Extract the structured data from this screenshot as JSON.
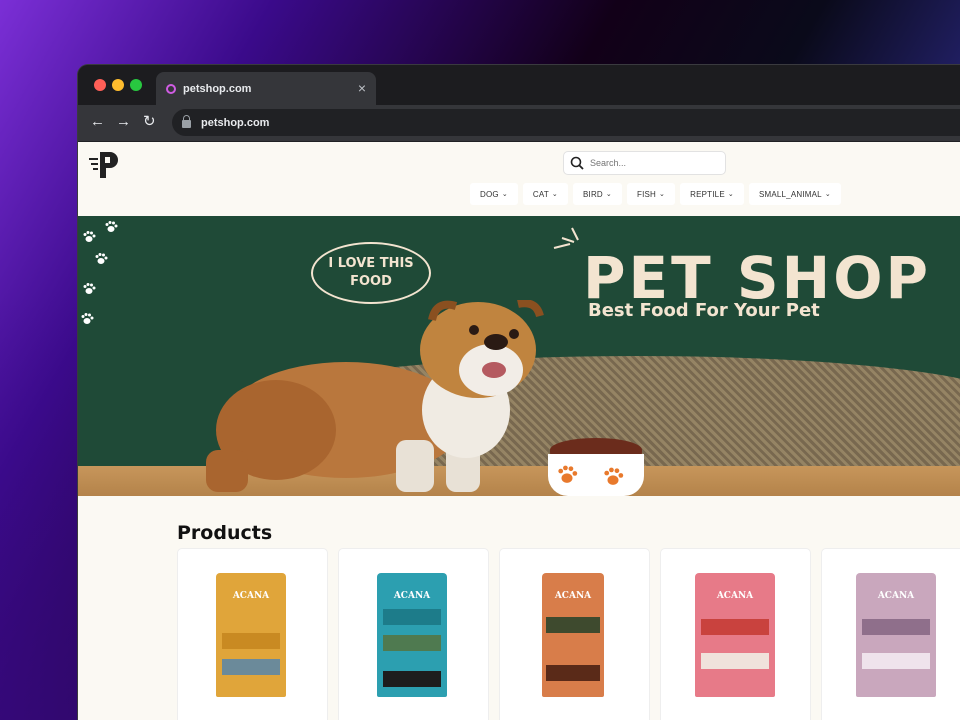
{
  "browser": {
    "tab_title": "petshop.com",
    "tab_close": "×",
    "url": "petshop.com",
    "back": "←",
    "forward": "→",
    "reload": "↻"
  },
  "site": {
    "search_placeholder": "Search...",
    "nav": [
      {
        "label": "DOG"
      },
      {
        "label": "CAT"
      },
      {
        "label": "BIRD"
      },
      {
        "label": "FISH"
      },
      {
        "label": "REPTILE"
      },
      {
        "label": "SMALL_ANIMAL"
      }
    ],
    "chevron": "⌄"
  },
  "hero": {
    "bubble_line1": "I LOVE THIS",
    "bubble_line2": "FOOD",
    "title": "PET SHOP",
    "subtitle": "Best Food For Your Pet"
  },
  "products": {
    "heading": "Products",
    "items": [
      {
        "brand": "ACANA",
        "color": "#e0a53a",
        "band": "#c98a22"
      },
      {
        "brand": "ACANA",
        "color": "#2c9fb0",
        "band": "#1d7c8a"
      },
      {
        "brand": "ACANA",
        "color": "#d87d4a",
        "band": "#3e4a2e"
      },
      {
        "brand": "ACANA",
        "color": "#e77a88",
        "band": "#c9423e"
      },
      {
        "brand": "ACANA",
        "color": "#c9a7bd",
        "band": "#8f6f8b"
      }
    ]
  },
  "colors": {
    "hero_bg": "#1f4a37",
    "page_bg": "#fbf9f3",
    "hero_text": "#f3e4d0"
  }
}
